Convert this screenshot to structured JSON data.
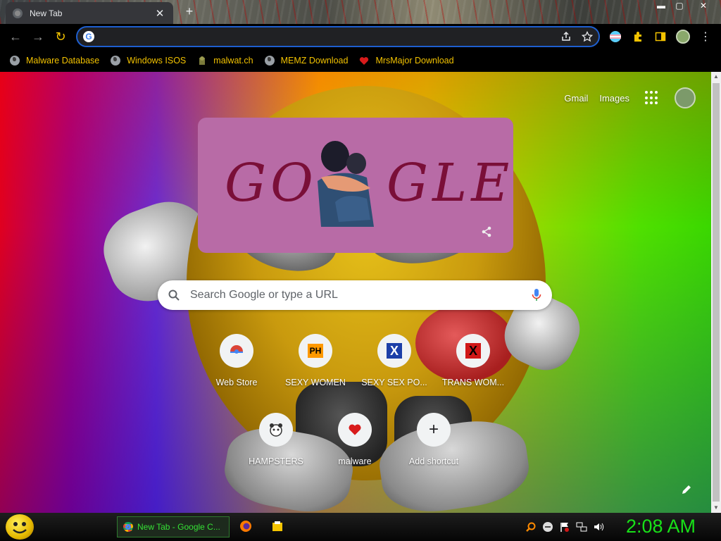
{
  "browser": {
    "tab": {
      "title": "New Tab",
      "close_glyph": "✕"
    },
    "new_tab_glyph": "+",
    "window_controls": {
      "minimize": "▬",
      "maximize": "▢",
      "close": "✕"
    },
    "toolbar": {
      "back": "←",
      "forward": "→",
      "reload": "↻",
      "omnibox_value": ""
    },
    "bookmarks": [
      {
        "label": "Malware Database",
        "icon": "globe-icon"
      },
      {
        "label": "Windows ISOS",
        "icon": "globe-icon"
      },
      {
        "label": "malwat.ch",
        "icon": "malwatch-icon"
      },
      {
        "label": "MEMZ Download",
        "icon": "globe-icon"
      },
      {
        "label": "MrsMajor Download",
        "icon": "heart-icon"
      }
    ]
  },
  "ntp": {
    "links": {
      "gmail": "Gmail",
      "images": "Images"
    },
    "doodle": {
      "left_text": "GO",
      "right_text": "GLE"
    },
    "search": {
      "placeholder": "Search Google or type a URL"
    },
    "shortcuts": [
      {
        "label": "Web Store",
        "icon": "web-store-icon"
      },
      {
        "label": "SEXY WOMEN",
        "icon": "ph-icon",
        "icon_text": "PH"
      },
      {
        "label": "SEXY SEX PO...",
        "icon": "x-blue-icon",
        "icon_text": "X"
      },
      {
        "label": "TRANS WOM...",
        "icon": "x-red-icon",
        "icon_text": "X"
      },
      {
        "label": "HAMPSTERS",
        "icon": "hamster-icon"
      },
      {
        "label": "malware",
        "icon": "heart-icon"
      },
      {
        "label": "Add shortcut",
        "icon": "plus-icon",
        "icon_text": "+"
      }
    ]
  },
  "taskbar": {
    "app_label": "New Tab - Google C...",
    "clock": "2:08 AM",
    "accent_color": "#18e018"
  },
  "colors": {
    "bookmark_text": "#f2c200",
    "omnibox_border": "#1e5fd0",
    "doodle_bg": "#b86ba6"
  }
}
